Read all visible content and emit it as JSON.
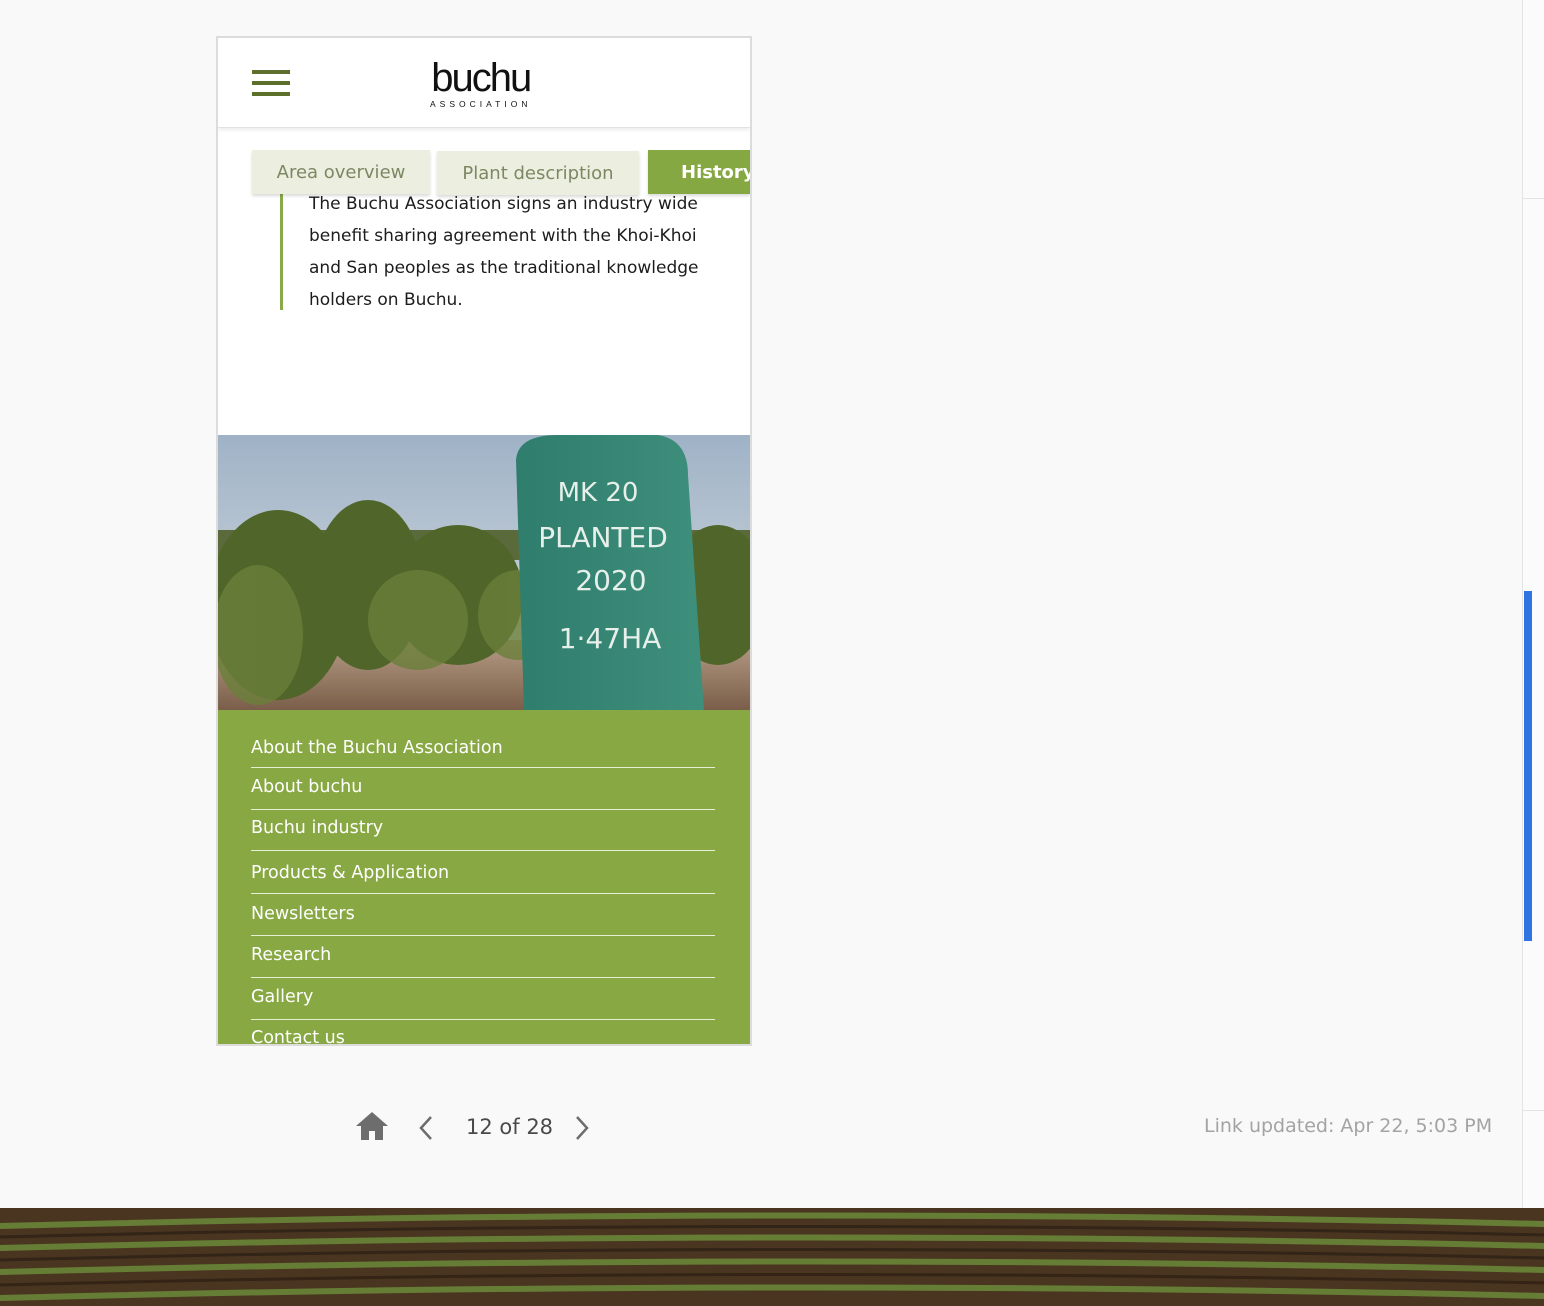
{
  "logo": {
    "main": "buchu",
    "sub": "ASSOCIATION"
  },
  "tabs": [
    {
      "label": "Area overview"
    },
    {
      "label": "Plant description"
    },
    {
      "label": "History"
    }
  ],
  "history_text": "The Buchu Association signs an industry wide benefit sharing agreement with the Khoi-Khoi and San peoples as the traditional knowledge holders on Buchu.",
  "photo_sign": {
    "line1": "MK 20",
    "line2": "PLANTED",
    "line3": "2020",
    "line4": "1·47HA"
  },
  "footer_nav": [
    {
      "label": "About the Buchu Association"
    },
    {
      "label": "About buchu"
    },
    {
      "label": "Buchu industry"
    },
    {
      "label": "Products & Application"
    },
    {
      "label": "Newsletters"
    },
    {
      "label": "Research"
    },
    {
      "label": "Gallery"
    },
    {
      "label": "Contact us"
    }
  ],
  "pager": {
    "label": "12 of 28",
    "current": 12,
    "total": 28
  },
  "link_updated": "Link updated: Apr 22, 5:03 PM",
  "colors": {
    "accent_green": "#88a843",
    "tab_inactive": "#ecefdf",
    "link_blue": "#2f74e0"
  }
}
